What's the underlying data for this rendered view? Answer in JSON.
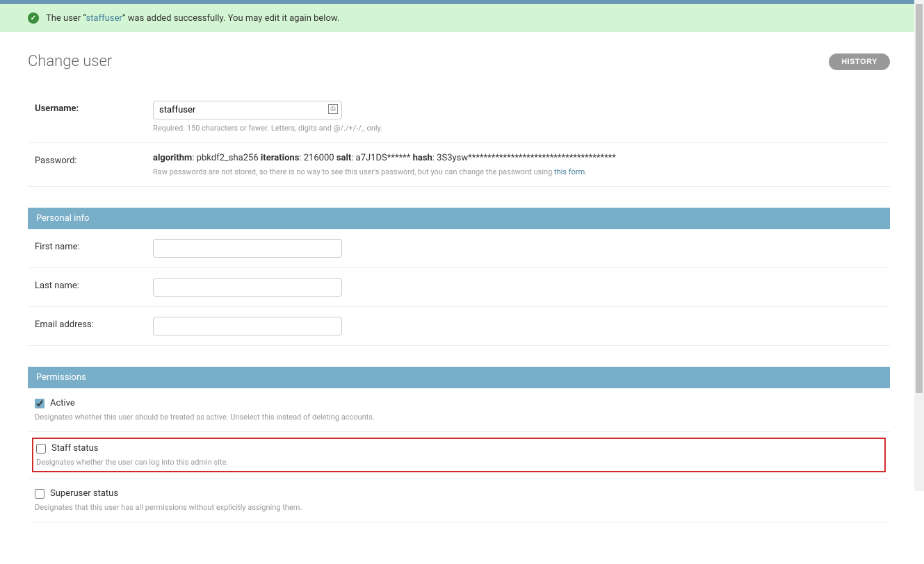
{
  "banner": {
    "prefix": "The user “",
    "user_link": "staffuser",
    "suffix": "” was added successfully. You may edit it again below."
  },
  "header": {
    "title": "Change user",
    "history_button": "HISTORY"
  },
  "fields": {
    "username": {
      "label": "Username:",
      "value": "staffuser",
      "help": "Required. 150 characters or fewer. Letters, digits and @/./+/-/_ only."
    },
    "password": {
      "label": "Password:",
      "algo_label": "algorithm",
      "algo_value": ": pbkdf2_sha256 ",
      "iter_label": "iterations",
      "iter_value": ": 216000 ",
      "salt_label": "salt",
      "salt_value": ": a7J1DS****** ",
      "hash_label": "hash",
      "hash_value": ": 3S3ysw**************************************",
      "help_prefix": "Raw passwords are not stored, so there is no way to see this user's password, but you can change the password using ",
      "help_link": "this form",
      "help_suffix": "."
    }
  },
  "sections": {
    "personal": {
      "title": "Personal info",
      "first_name": {
        "label": "First name:",
        "value": ""
      },
      "last_name": {
        "label": "Last name:",
        "value": ""
      },
      "email": {
        "label": "Email address:",
        "value": ""
      }
    },
    "permissions": {
      "title": "Permissions",
      "active": {
        "label": "Active",
        "checked": true,
        "help": "Designates whether this user should be treated as active. Unselect this instead of deleting accounts."
      },
      "staff": {
        "label": "Staff status",
        "checked": false,
        "help": "Designates whether the user can log into this admin site."
      },
      "superuser": {
        "label": "Superuser status",
        "checked": false,
        "help": "Designates that this user has all permissions without explicitly assigning them."
      }
    }
  }
}
